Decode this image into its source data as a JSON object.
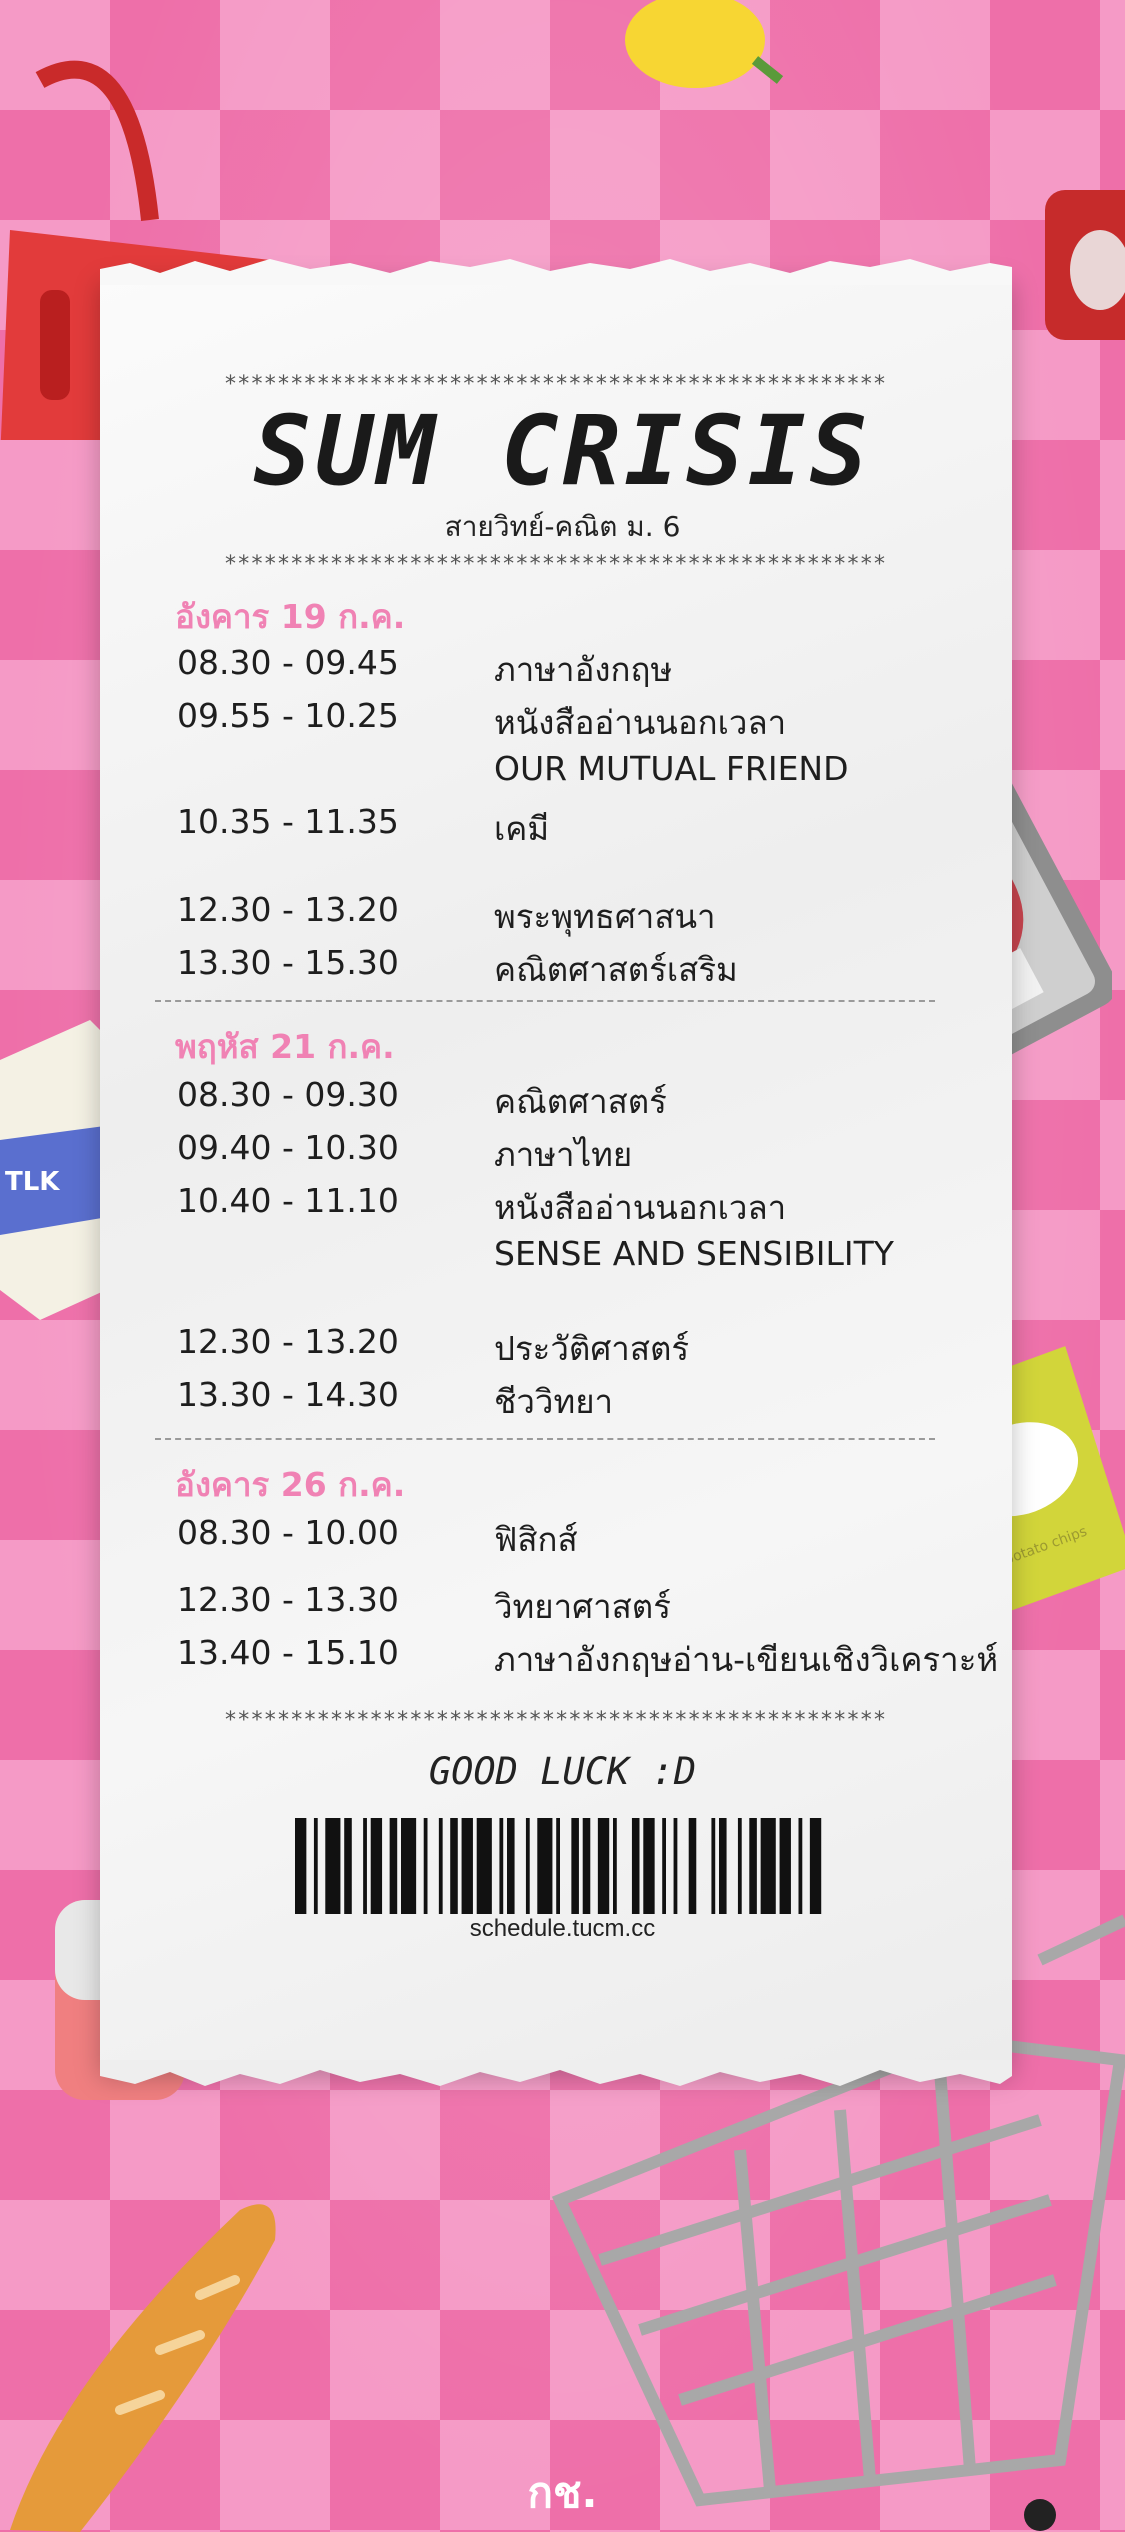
{
  "header": {
    "title": "SUM CRISIS",
    "subtitle": "สายวิทย์-คณิต ม. 6",
    "stars": "**************************************************"
  },
  "days": [
    {
      "date": "อังคาร 19 ก.ค.",
      "rows": [
        {
          "time": "08.30 - 09.45",
          "subject": "ภาษาอังกฤษ"
        },
        {
          "time": "09.55 - 10.25",
          "subject": "หนังสืออ่านนอกเวลา"
        },
        {
          "time": "",
          "subject": "OUR MUTUAL FRIEND"
        },
        {
          "time": "10.35 - 11.35",
          "subject": "เคมี"
        },
        {
          "time": "12.30 - 13.20",
          "subject": "พระพุทธศาสนา"
        },
        {
          "time": "13.30 - 15.30",
          "subject": "คณิตศาสตร์เสริม"
        }
      ]
    },
    {
      "date": "พฤหัส 21 ก.ค.",
      "rows": [
        {
          "time": "08.30 - 09.30",
          "subject": "คณิตศาสตร์"
        },
        {
          "time": "09.40 - 10.30",
          "subject": "ภาษาไทย"
        },
        {
          "time": "10.40 - 11.10",
          "subject": "หนังสืออ่านนอกเวลา"
        },
        {
          "time": "",
          "subject": "SENSE AND SENSIBILITY"
        },
        {
          "time": "12.30 - 13.20",
          "subject": "ประวัติศาสตร์"
        },
        {
          "time": "13.30 - 14.30",
          "subject": "ชีววิทยา"
        }
      ]
    },
    {
      "date": "อังคาร 26 ก.ค.",
      "rows": [
        {
          "time": "08.30 - 10.00",
          "subject": "ฟิสิกส์"
        },
        {
          "time": "12.30 - 13.30",
          "subject": "วิทยาศาสตร์"
        },
        {
          "time": "13.40 - 15.10",
          "subject": "ภาษาอังกฤษอ่าน-เขียนเชิงวิเคราะห์"
        }
      ]
    }
  ],
  "closing": {
    "message": "GOOD LUCK :D",
    "url": "schedule.tucm.cc"
  },
  "footer": {
    "signature": "กช."
  },
  "decorations": {
    "milk_label": "TLK",
    "chips_label": "potato chips"
  },
  "colors": {
    "background_pink": "#f59ac6",
    "checker_pink": "#ee6fa9",
    "date_heading": "#f082b4"
  },
  "icons": [
    "basket-icon",
    "lemon-icon",
    "can-icon",
    "meat-tray-icon",
    "orange-icon",
    "milk-carton-icon",
    "chips-bag-icon",
    "tin-can-icon",
    "bread-icon",
    "shopping-cart-icon"
  ]
}
